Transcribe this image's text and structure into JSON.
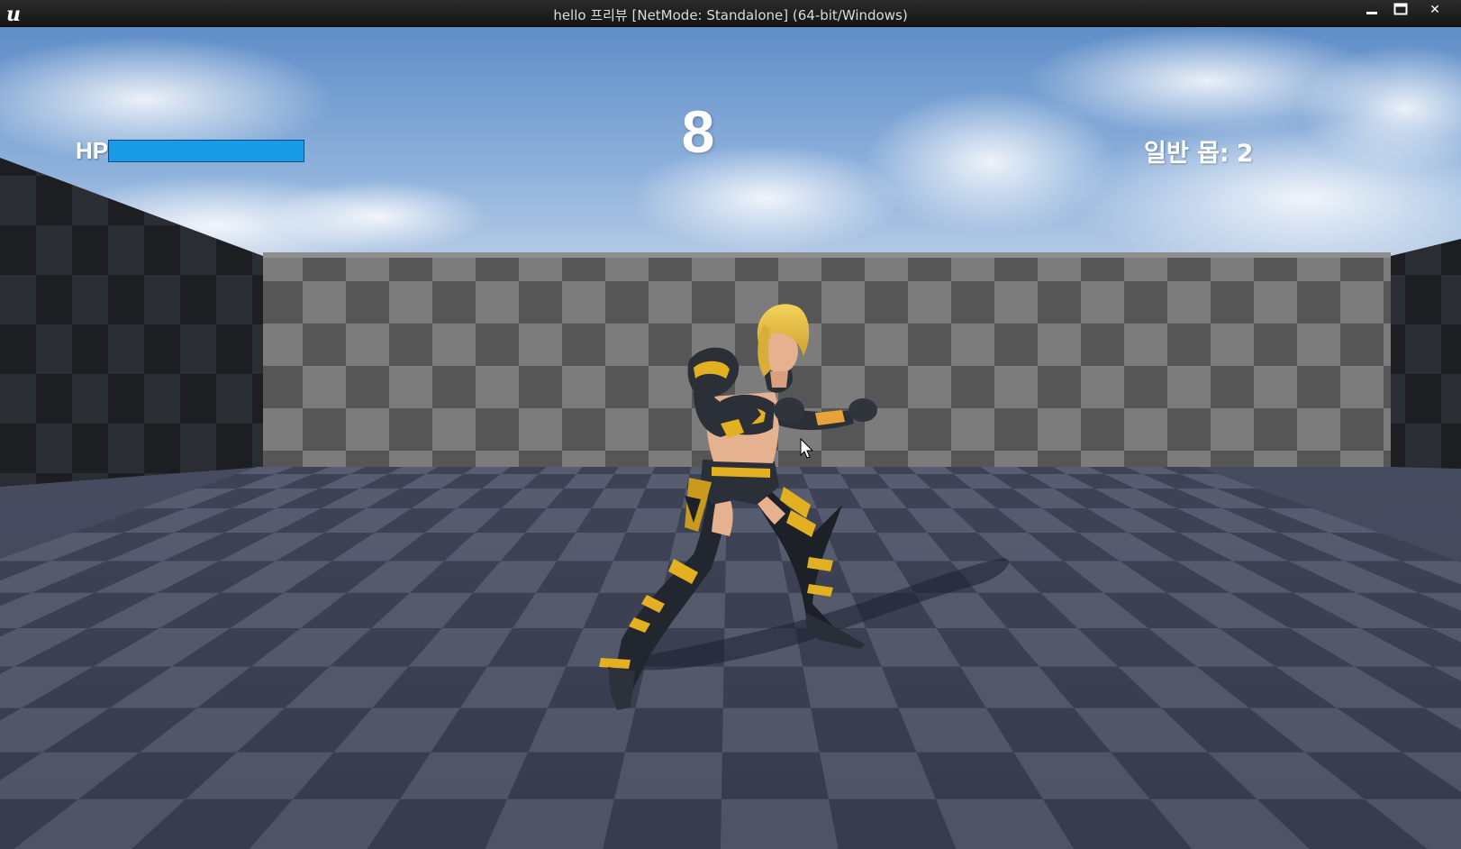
{
  "window": {
    "title": "hello 프리뷰 [NetMode: Standalone] (64-bit/Windows)",
    "minimize_icon": "minimize-icon",
    "maximize_icon": "maximize-icon",
    "close_icon": "close-icon",
    "close_glyph": "✕"
  },
  "hud": {
    "hp_label": "HP",
    "hp_fraction": 1.0,
    "hp_color": "#1a9be8",
    "timer": "8",
    "enemy_label": "일반 몹:",
    "enemy_count": "2"
  },
  "scene": {
    "sky_color": "#6f9bd0",
    "floor_color": "#4b5163",
    "wall_light": "#7a7a7a",
    "wall_dark": "#4f4f4f",
    "side_wall_dark": "#22252b",
    "character": "female-armored-fighter",
    "accent_yellow": "#e2b020"
  }
}
